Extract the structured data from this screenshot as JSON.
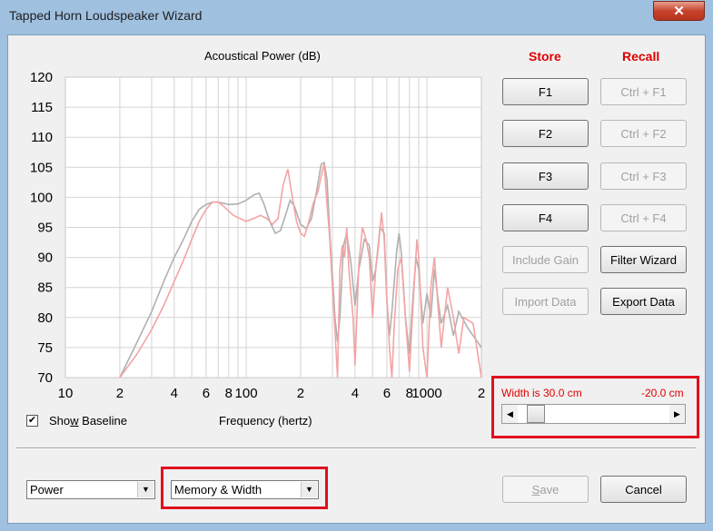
{
  "window": {
    "title": "Tapped Horn Loudspeaker Wizard",
    "close_glyph": "✕"
  },
  "plot": {
    "title": "Acoustical Power (dB)",
    "xlabel": "Frequency (hertz)"
  },
  "headers": {
    "store": "Store",
    "recall": "Recall"
  },
  "store_buttons": [
    "F1",
    "F2",
    "F3",
    "F4"
  ],
  "recall_buttons": [
    "Ctrl + F1",
    "Ctrl + F2",
    "Ctrl + F3",
    "Ctrl + F4"
  ],
  "actions": {
    "include_gain": "Include Gain",
    "filter_wizard": "Filter Wizard",
    "import_data": "Import Data",
    "export_data": "Export Data"
  },
  "show_baseline": {
    "label": "Show Baseline",
    "checked": true,
    "check_glyph": "✔"
  },
  "width_control": {
    "label": "Width is 30.0 cm",
    "value_text": "-20.0 cm",
    "left_arrow": "◀",
    "right_arrow": "▶",
    "position": 0.05
  },
  "combos": {
    "mode": "Power",
    "memory": "Memory & Width",
    "arrow": "▼"
  },
  "footer": {
    "save": "Save",
    "cancel": "Cancel"
  },
  "colors": {
    "accent_red": "#e00000",
    "baseline": "#b0b0b0",
    "current": "#f4a4a4"
  },
  "chart_data": {
    "type": "line",
    "title": "Acoustical Power (dB)",
    "xlabel": "Frequency (hertz)",
    "ylabel": "",
    "xscale": "log",
    "xlim": [
      10,
      2000
    ],
    "ylim": [
      70,
      120
    ],
    "yticks": [
      70,
      75,
      80,
      85,
      90,
      95,
      100,
      105,
      110,
      115,
      120
    ],
    "xticks": [
      {
        "v": 10,
        "label": "10"
      },
      {
        "v": 20,
        "label": "2"
      },
      {
        "v": 40,
        "label": "4"
      },
      {
        "v": 60,
        "label": "6"
      },
      {
        "v": 80,
        "label": "8"
      },
      {
        "v": 100,
        "label": "100"
      },
      {
        "v": 200,
        "label": "2"
      },
      {
        "v": 400,
        "label": "4"
      },
      {
        "v": 600,
        "label": "6"
      },
      {
        "v": 800,
        "label": "8"
      },
      {
        "v": 1000,
        "label": "1000"
      },
      {
        "v": 2000,
        "label": "2"
      }
    ],
    "grid": true,
    "series": [
      {
        "color": "#b0b0b0",
        "points": [
          [
            20,
            70
          ],
          [
            25,
            76
          ],
          [
            30,
            81
          ],
          [
            35,
            86
          ],
          [
            40,
            90
          ],
          [
            45,
            93
          ],
          [
            50,
            96
          ],
          [
            55,
            98
          ],
          [
            60,
            98.8
          ],
          [
            65,
            99.2
          ],
          [
            70,
            99.2
          ],
          [
            80,
            98.8
          ],
          [
            90,
            98.9
          ],
          [
            100,
            99.5
          ],
          [
            110,
            100.4
          ],
          [
            118,
            100.7
          ],
          [
            125,
            99
          ],
          [
            135,
            96
          ],
          [
            145,
            94
          ],
          [
            155,
            94.5
          ],
          [
            165,
            97
          ],
          [
            175,
            99.5
          ],
          [
            185,
            98.5
          ],
          [
            200,
            95.5
          ],
          [
            215,
            94.8
          ],
          [
            230,
            96.5
          ],
          [
            245,
            101
          ],
          [
            260,
            105.5
          ],
          [
            270,
            105.8
          ],
          [
            280,
            103
          ],
          [
            290,
            94
          ],
          [
            300,
            87
          ],
          [
            310,
            80
          ],
          [
            320,
            76
          ],
          [
            330,
            80
          ],
          [
            345,
            92
          ],
          [
            360,
            94
          ],
          [
            380,
            89
          ],
          [
            400,
            82
          ],
          [
            420,
            88
          ],
          [
            450,
            93
          ],
          [
            480,
            92
          ],
          [
            500,
            86
          ],
          [
            520,
            88
          ],
          [
            550,
            95
          ],
          [
            580,
            94
          ],
          [
            600,
            83
          ],
          [
            620,
            77
          ],
          [
            640,
            81
          ],
          [
            680,
            91
          ],
          [
            700,
            94
          ],
          [
            720,
            91
          ],
          [
            760,
            80
          ],
          [
            800,
            74
          ],
          [
            830,
            82
          ],
          [
            870,
            90
          ],
          [
            900,
            88
          ],
          [
            950,
            79
          ],
          [
            1000,
            84
          ],
          [
            1050,
            80
          ],
          [
            1100,
            88
          ],
          [
            1150,
            83
          ],
          [
            1200,
            79
          ],
          [
            1300,
            82
          ],
          [
            1400,
            77
          ],
          [
            1500,
            81
          ],
          [
            1700,
            78
          ],
          [
            1900,
            76
          ],
          [
            2000,
            75
          ]
        ]
      },
      {
        "color": "#f4a4a4",
        "points": [
          [
            20,
            70
          ],
          [
            25,
            74
          ],
          [
            30,
            78
          ],
          [
            35,
            82
          ],
          [
            40,
            86
          ],
          [
            45,
            89.5
          ],
          [
            50,
            93
          ],
          [
            55,
            96
          ],
          [
            60,
            98
          ],
          [
            65,
            99.2
          ],
          [
            70,
            99.2
          ],
          [
            75,
            98.5
          ],
          [
            85,
            97
          ],
          [
            100,
            96
          ],
          [
            110,
            96.5
          ],
          [
            120,
            97
          ],
          [
            130,
            96.5
          ],
          [
            140,
            95.5
          ],
          [
            150,
            96.5
          ],
          [
            160,
            102
          ],
          [
            170,
            104.7
          ],
          [
            180,
            100
          ],
          [
            190,
            96
          ],
          [
            200,
            94
          ],
          [
            210,
            93.5
          ],
          [
            220,
            95.5
          ],
          [
            235,
            99
          ],
          [
            250,
            101
          ],
          [
            260,
            103.5
          ],
          [
            270,
            105.6
          ],
          [
            280,
            99
          ],
          [
            290,
            93
          ],
          [
            300,
            85
          ],
          [
            310,
            78
          ],
          [
            320,
            70
          ],
          [
            330,
            88
          ],
          [
            340,
            92
          ],
          [
            350,
            90
          ],
          [
            360,
            95
          ],
          [
            370,
            88
          ],
          [
            390,
            80
          ],
          [
            400,
            72
          ],
          [
            420,
            89
          ],
          [
            440,
            95
          ],
          [
            460,
            93
          ],
          [
            480,
            90
          ],
          [
            500,
            80
          ],
          [
            520,
            88
          ],
          [
            540,
            92
          ],
          [
            560,
            97.5
          ],
          [
            580,
            93
          ],
          [
            600,
            83
          ],
          [
            620,
            75
          ],
          [
            640,
            70
          ],
          [
            660,
            79
          ],
          [
            690,
            88
          ],
          [
            720,
            90
          ],
          [
            760,
            80
          ],
          [
            800,
            71
          ],
          [
            830,
            80
          ],
          [
            860,
            88
          ],
          [
            880,
            93
          ],
          [
            900,
            90
          ],
          [
            950,
            75
          ],
          [
            1000,
            70
          ],
          [
            1050,
            85
          ],
          [
            1100,
            90
          ],
          [
            1150,
            82
          ],
          [
            1200,
            75
          ],
          [
            1300,
            85
          ],
          [
            1400,
            80
          ],
          [
            1500,
            74
          ],
          [
            1600,
            80
          ],
          [
            1800,
            79
          ],
          [
            2000,
            70
          ]
        ]
      }
    ]
  }
}
